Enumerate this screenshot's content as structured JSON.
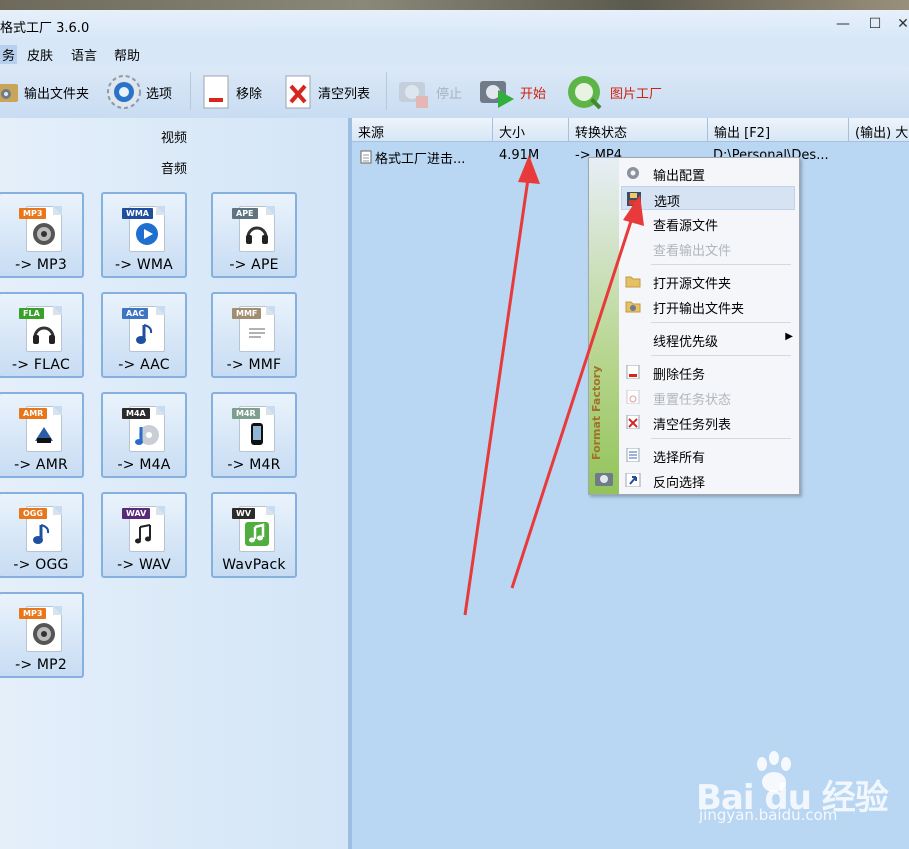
{
  "window": {
    "title": "格式工厂 3.6.0",
    "minimize": "—",
    "maximize": "☐",
    "close": "✕"
  },
  "menubar": [
    {
      "label": "务",
      "active": true
    },
    {
      "label": "皮肤"
    },
    {
      "label": "语言"
    },
    {
      "label": "帮助"
    }
  ],
  "toolbar": {
    "output_folder": "输出文件夹",
    "options": "选项",
    "remove": "移除",
    "clear_list": "清空列表",
    "stop": "停止",
    "start": "开始",
    "picture_factory": "图片工厂"
  },
  "left": {
    "categories": [
      "视频",
      "音频"
    ],
    "tiles": [
      {
        "label": "-> MP3",
        "tag": "MP3",
        "tag_color": "#e8761a",
        "icon": "speaker-icon"
      },
      {
        "label": "-> WMA",
        "tag": "WMA",
        "tag_color": "#1f4f9c",
        "icon": "play-disc-icon"
      },
      {
        "label": "-> APE",
        "tag": "APE",
        "tag_color": "#5f7480",
        "icon": "headphones-icon"
      },
      {
        "label": "-> FLAC",
        "tag": "FLA",
        "tag_color": "#39a12a",
        "icon": "headphones-icon"
      },
      {
        "label": "-> AAC",
        "tag": "AAC",
        "tag_color": "#3d74c4",
        "icon": "music-note-icon"
      },
      {
        "label": "-> MMF",
        "tag": "MMF",
        "tag_color": "#a08e70",
        "icon": "document-icon"
      },
      {
        "label": "-> AMR",
        "tag": "AMR",
        "tag_color": "#e8761a",
        "icon": "device-icon"
      },
      {
        "label": "-> M4A",
        "tag": "M4A",
        "tag_color": "#2b2b2b",
        "icon": "disc-note-icon"
      },
      {
        "label": "-> M4R",
        "tag": "M4R",
        "tag_color": "#7e9e8f",
        "icon": "phone-icon"
      },
      {
        "label": "-> OGG",
        "tag": "OGG",
        "tag_color": "#e8761a",
        "icon": "music-note-icon"
      },
      {
        "label": "-> WAV",
        "tag": "WAV",
        "tag_color": "#5a2a7a",
        "icon": "music-notes-icon"
      },
      {
        "label": "WavPack",
        "tag": "WV",
        "tag_color": "#2b2b2b",
        "icon": "music-note-green-icon"
      },
      {
        "label": "-> MP2",
        "tag": "MP3",
        "tag_color": "#e8761a",
        "icon": "speaker-icon"
      }
    ]
  },
  "table": {
    "columns": [
      "来源",
      "大小",
      "转换状态",
      "输出 [F2]",
      "(输出) 大"
    ],
    "rows": [
      {
        "source": "格式工厂进击...",
        "size": "4.91M",
        "status": "-> MP4",
        "output": "D:\\Personal\\Des..."
      }
    ]
  },
  "context_menu": {
    "strip_text": "Format Factory",
    "items": [
      {
        "label": "输出配置",
        "icon": "gear-icon",
        "disabled": false
      },
      {
        "label": "选项",
        "icon": "floppy-icon",
        "disabled": false,
        "highlighted": true
      },
      {
        "label": "查看源文件",
        "icon": "none",
        "disabled": false
      },
      {
        "label": "查看输出文件",
        "icon": "none",
        "disabled": true
      },
      {
        "label": "打开源文件夹",
        "icon": "folder-icon",
        "disabled": false
      },
      {
        "label": "打开输出文件夹",
        "icon": "folder-output-icon",
        "disabled": false
      },
      {
        "label": "线程优先级",
        "icon": "none",
        "disabled": false,
        "submenu": "▶"
      },
      {
        "label": "删除任务",
        "icon": "remove-doc-icon",
        "disabled": false
      },
      {
        "label": "重置任务状态",
        "icon": "reset-icon",
        "disabled": true
      },
      {
        "label": "清空任务列表",
        "icon": "clear-x-icon",
        "disabled": false
      },
      {
        "label": "选择所有",
        "icon": "checklist-icon",
        "disabled": false
      },
      {
        "label": "反向选择",
        "icon": "invert-arrow-icon",
        "disabled": false
      }
    ]
  },
  "watermark": {
    "brand": "Bai du 经验",
    "url": "jingyan.baidu.com"
  },
  "colors": {
    "annotation_arrow": "#e83a3a",
    "accent": "#86b1de",
    "background": "#b9d6f3"
  }
}
